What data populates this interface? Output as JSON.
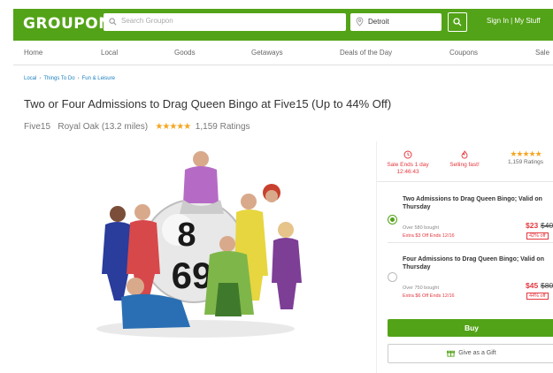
{
  "header": {
    "logo": "GROUPON",
    "search_placeholder": "Search Groupon",
    "location": "Detroit",
    "account": "Sign In | My Stuff"
  },
  "nav": [
    "Home",
    "Local",
    "Goods",
    "Getaways",
    "Deals of the Day",
    "Coupons",
    "Sale"
  ],
  "breadcrumb": [
    "Local",
    "Things To Do",
    "Fun & Leisure"
  ],
  "deal": {
    "title": "Two or Four Admissions to Drag Queen Bingo at Five15 (Up to 44% Off)",
    "merchant": "Five15",
    "location": "Royal Oak (13.2 miles)",
    "rating_stars": "★★★★★",
    "ratings": "1,159 Ratings",
    "image_text": [
      "8",
      "69"
    ]
  },
  "stats": {
    "sale_label": "Sale Ends 1 day",
    "sale_time": "12:46:43",
    "selling": "Selling fast!",
    "stars": "★★★★★",
    "ratings": "1,159 Ratings"
  },
  "options": [
    {
      "name": "Two Admissions to Drag Queen Bingo; Valid on Thursday",
      "bought": "Over 580 bought",
      "extra": "Extra $3 Off Ends 12/16",
      "price": "$23",
      "original": "$40",
      "discount": "42% off"
    },
    {
      "name": "Four Admissions to Drag Queen Bingo; Valid on Thursday",
      "bought": "Over 750 bought",
      "extra": "Extra $6 Off Ends 12/16",
      "price": "$45",
      "original": "$80",
      "discount": "44% off"
    }
  ],
  "actions": {
    "buy": "Buy",
    "gift": "Give as a Gift"
  },
  "colors": {
    "brand_green": "#53a318",
    "alert_red": "#e4383e",
    "star_gold": "#f5a623"
  }
}
